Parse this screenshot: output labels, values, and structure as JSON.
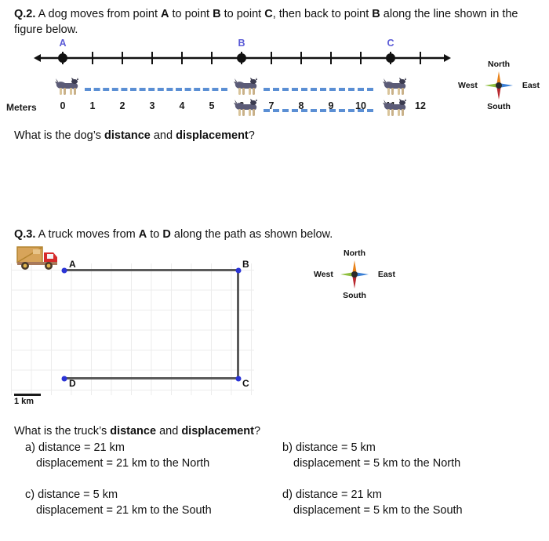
{
  "questions": {
    "q2": {
      "number": "Q.2.",
      "text_part1": "A dog moves from point ",
      "a": "A",
      "text_part2": " to point ",
      "b": "B",
      "text_part3": " to point ",
      "c": "C",
      "text_part4": ", then back to point ",
      "b2": "B",
      "text_part5": " along the line shown in the figure below.",
      "prompt_pre": "What is the dog’s ",
      "prompt_b1": "distance",
      "prompt_mid": " and ",
      "prompt_b2": "displacement",
      "prompt_post": "?",
      "axis_caption": "Meters",
      "tick_labels": [
        "0",
        "1",
        "2",
        "3",
        "4",
        "5",
        "6",
        "7",
        "8",
        "9",
        "10",
        "11",
        "12"
      ],
      "point_labels": [
        {
          "label": "A",
          "value": 0
        },
        {
          "label": "B",
          "value": 6
        },
        {
          "label": "C",
          "value": 11
        }
      ],
      "axis_min": 0,
      "axis_max": 12,
      "axis_unit": "Meters"
    },
    "q3": {
      "number": "Q.3.",
      "text_part1": "A truck moves from ",
      "a": "A",
      "text_part2": " to ",
      "d": "D",
      "text_part3": " along the path as shown below.",
      "prompt_pre": "What is the truck’s ",
      "prompt_b1": "distance",
      "prompt_mid": " and ",
      "prompt_b2": "displacement",
      "prompt_post": "?",
      "scale_label": "1 km",
      "node_labels": {
        "a": "A",
        "b": "B",
        "c": "C",
        "d": "D"
      },
      "options": [
        {
          "key": "a)",
          "line1": "distance = 21 km",
          "line2": "displacement = 21 km to the North"
        },
        {
          "key": "b)",
          "line1": "distance = 5 km",
          "line2": "displacement = 5 km to the North"
        },
        {
          "key": "c)",
          "line1": "distance = 5 km",
          "line2": "displacement = 21 km to the South"
        },
        {
          "key": "d)",
          "line1": "distance = 21 km",
          "line2": "displacement = 5 km to the South"
        }
      ]
    }
  },
  "compass": {
    "north": "North",
    "south": "South",
    "east": "East",
    "west": "West"
  },
  "colors": {
    "point_label": "#5b5bd6",
    "dash": "#5b8fd4",
    "node_dot": "#2b34d6",
    "path": "#5a5a5a",
    "compass_north": "#e8821a",
    "compass_east": "#3a7fd5",
    "compass_west": "#8fbf3f",
    "compass_south": "#9a9a9a"
  }
}
